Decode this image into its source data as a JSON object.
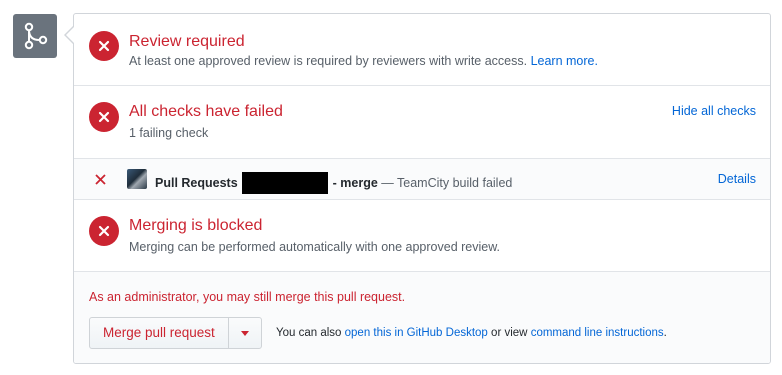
{
  "review": {
    "title": "Review required",
    "desc": "At least one approved review is required by reviewers with write access.",
    "learn_more": "Learn more."
  },
  "checks": {
    "title": "All checks have failed",
    "count": "1 failing check",
    "hide_label": "Hide all checks",
    "row": {
      "name": "Pull Requests",
      "branch": "- merge",
      "status": "— TeamCity build failed",
      "details": "Details"
    }
  },
  "blocked": {
    "title": "Merging is blocked",
    "desc": "Merging can be performed automatically with one approved review."
  },
  "admin": {
    "note": "As an administrator, you may still merge this pull request.",
    "merge_button": "Merge pull request",
    "alt_prefix": "You can also",
    "desktop_link": "open this in GitHub Desktop",
    "alt_middle": "or view",
    "cli_link": "command line instructions",
    "alt_suffix": "."
  },
  "colors": {
    "error": "#cb2431",
    "link": "#0366d6",
    "icon_bg": "#6a737d"
  },
  "icons": [
    "git-merge-icon",
    "x-circle-icon",
    "x-icon",
    "avatar",
    "caret-down-icon"
  ]
}
